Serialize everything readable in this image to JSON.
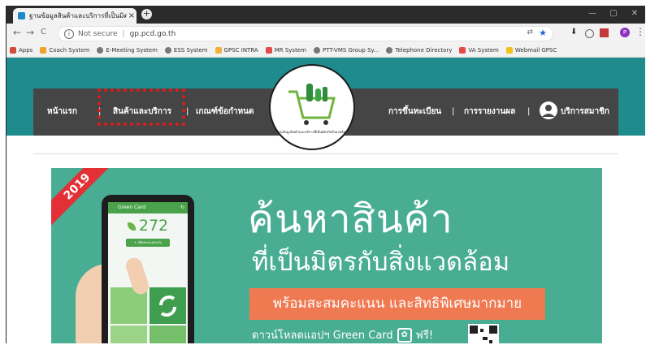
{
  "browser": {
    "tab_title": "ฐานข้อมูลสินค้าและบริการที่เป็นมิตรกับสิ่งแวดล้อม",
    "tab_close": "×",
    "new_tab": "+",
    "window_controls": [
      "—",
      "▢",
      "✕"
    ],
    "back": "←",
    "forward": "→",
    "reload": "C",
    "info_icon": "i",
    "security_label": "Not secure",
    "url": "gp.pcd.go.th",
    "translate_icon": "⇄",
    "star_icon": "★",
    "download_icon": "⬇",
    "profile_initial": "P",
    "menu_icon": "⋮"
  },
  "bookmarks": [
    {
      "label": "Apps",
      "color": "#d24a3a"
    },
    {
      "label": "Coach System",
      "color": "#f0a22b"
    },
    {
      "label": "E-Meeting System",
      "color": "#777777"
    },
    {
      "label": "ESS System",
      "color": "#777777"
    },
    {
      "label": "GPSC INTRA",
      "color": "#f2b03a"
    },
    {
      "label": "MR System",
      "color": "#e34b4b"
    },
    {
      "label": "PTT-VMS Group Sy...",
      "color": "#777777"
    },
    {
      "label": "Telephone Directory",
      "color": "#777777"
    },
    {
      "label": "VA System",
      "color": "#e34b4b"
    },
    {
      "label": "Webmail GPSC",
      "color": "#f2c21b"
    }
  ],
  "nav": {
    "home": "หน้าแรก",
    "products": "สินค้าและบริการ",
    "criteria": "เกณฑ์ข้อกำหนด",
    "register": "การขึ้นทะเบียน",
    "reports": "การรายงานผล",
    "member": "บริการสมาชิก",
    "sep": "|",
    "logo_caption": "ฐานข้อมูลสินค้าและบริการที่เป็นมิตรกับสิ่งแวดล้อม"
  },
  "banner": {
    "year": "2019",
    "headline": "ค้นหาสินค้า",
    "subheadline": "ที่เป็นมิตรกับสิ่งแวดล้อม",
    "promo": "พร้อมสะสมคะแนน และสิทธิพิเศษมากมาย",
    "download_prefix": "ดาวน์โหลดแอปฯ Green Card",
    "download_suffix": "ฟรี!",
    "app_title": "Green Card",
    "app_points": "272",
    "app_button": "+ เพิ่มคะแนนสะสม"
  },
  "colors": {
    "teal": "#1f8b8c",
    "nav_bg": "#454545",
    "banner_bg": "#48ad92",
    "promo": "#ef7a52",
    "highlight": "#e01a1a"
  }
}
